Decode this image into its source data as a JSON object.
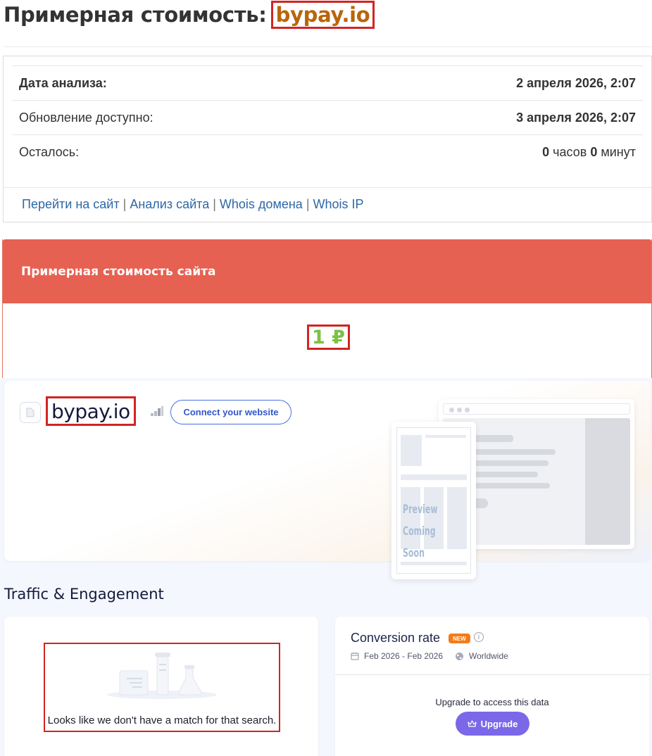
{
  "page": {
    "title_prefix": "Примерная стоимость:",
    "domain": "bypay.io"
  },
  "analysis": {
    "rows": [
      {
        "label": "Дата анализа:",
        "value": "2 апреля 2026, 2:07"
      },
      {
        "label": "Обновление доступно:",
        "value": "3 апреля 2026, 2:07"
      },
      {
        "label": "Осталось:",
        "hours": "0",
        "hours_unit": "часов",
        "minutes": "0",
        "minutes_unit": "минут"
      }
    ],
    "links": [
      "Перейти на сайт",
      "Анализ сайта",
      "Whois домена",
      "Whois IP"
    ],
    "separator": "|"
  },
  "valuation": {
    "heading": "Примерная стоимость сайта",
    "amount": "1 ₽"
  },
  "similarweb": {
    "domain": "bypay.io",
    "connect_label": "Connect your website",
    "preview_line1": "Preview",
    "preview_line2": "Coming Soon",
    "section_title": "Traffic & Engagement",
    "empty_message": "Looks like we don't have a match for that search.",
    "conversion": {
      "title": "Conversion rate",
      "badge": "NEW",
      "date_range": "Feb 2026 - Feb 2026",
      "region": "Worldwide",
      "upgrade_text": "Upgrade to access this data",
      "upgrade_label": "Upgrade"
    }
  },
  "colors": {
    "domain_highlight": "#b8660b",
    "annotation_box": "#d22424",
    "valuation_header": "#e66151",
    "amount": "#7cc243",
    "link": "#2d67a6",
    "upgrade_button": "#7a68e8",
    "new_badge": "#f57b17"
  },
  "icons": [
    "file-icon",
    "rank-bars-icon",
    "calendar-icon",
    "globe-icon",
    "info-icon",
    "crown-icon"
  ]
}
